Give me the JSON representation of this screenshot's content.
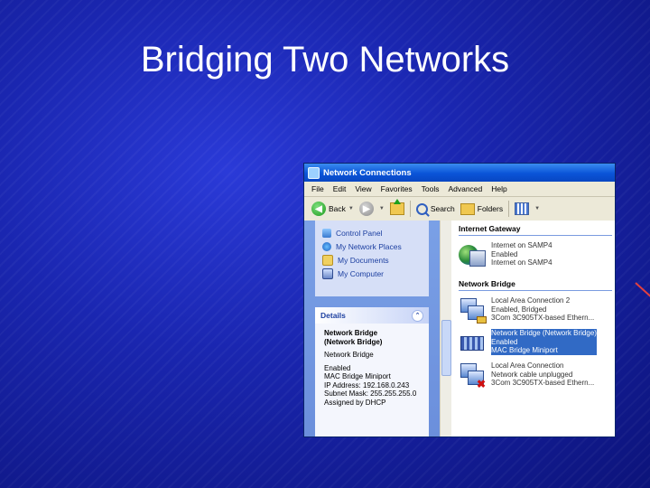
{
  "slide": {
    "title": "Bridging Two Networks"
  },
  "window": {
    "title": "Network Connections"
  },
  "menu": [
    "File",
    "Edit",
    "View",
    "Favorites",
    "Tools",
    "Advanced",
    "Help"
  ],
  "toolbar": {
    "back": "Back",
    "search": "Search",
    "folders": "Folders"
  },
  "tasks": {
    "links": [
      "Control Panel",
      "My Network Places",
      "My Documents",
      "My Computer"
    ]
  },
  "details": {
    "header": "Details",
    "name_line1": "Network Bridge",
    "name_line2": "(Network Bridge)",
    "type": "Network Bridge",
    "status": "Enabled",
    "device": "MAC Bridge Miniport",
    "ip": "IP Address: 192.168.0.243",
    "subnet": "Subnet Mask: 255.255.255.0",
    "assigned": "Assigned by DHCP"
  },
  "groups": {
    "gateway": {
      "header": "Internet Gateway",
      "item": {
        "line1": "Internet on SAMP4",
        "line2": "Enabled",
        "line3": "Internet on SAMP4"
      }
    },
    "bridge": {
      "header": "Network Bridge",
      "items": [
        {
          "line1": "Local Area Connection 2",
          "line2": "Enabled, Bridged",
          "line3": "3Com 3C905TX-based Ethern..."
        },
        {
          "line1": "Network Bridge (Network Bridge)",
          "line2": "Enabled",
          "line3": "MAC Bridge Miniport"
        },
        {
          "line1": "Local Area Connection",
          "line2": "Network cable unplugged",
          "line3": "3Com 3C905TX-based Ethern..."
        }
      ]
    }
  }
}
